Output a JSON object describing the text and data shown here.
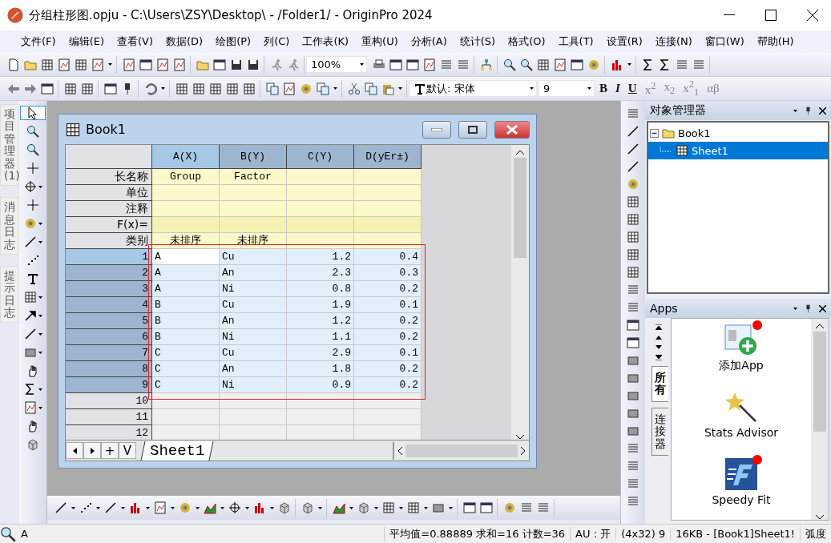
{
  "window": {
    "title": "分组柱形图.opju - C:\\Users\\ZSY\\Desktop\\ - /Folder1/ - OriginPro 2024"
  },
  "menu": [
    "文件(F)",
    "编辑(E)",
    "查看(V)",
    "数据(D)",
    "绘图(P)",
    "列(C)",
    "工作表(K)",
    "重构(U)",
    "分析(A)",
    "统计(S)",
    "格式(O)",
    "工具(T)",
    "设置(R)",
    "连接(N)",
    "窗口(W)",
    "帮助(H)"
  ],
  "toolbar": {
    "zoom": "100%",
    "font": "默认: 宋体",
    "font_size": "9",
    "format_buttons": [
      {
        "label": "B",
        "kind": "bold"
      },
      {
        "label": "I",
        "kind": "italic"
      },
      {
        "label": "U",
        "kind": "underline"
      },
      {
        "label": "x$^{2}$",
        "kind": "script"
      },
      {
        "label": "x$_{2}$",
        "kind": "script"
      },
      {
        "label": "x$^{2}$$_{1}$",
        "kind": "script"
      },
      {
        "label": "αβ",
        "kind": "script"
      }
    ]
  },
  "side_tabs": [
    {
      "label": "项目管理器 (1)"
    },
    {
      "label": "消息日志"
    },
    {
      "label": "提示日志"
    }
  ],
  "workbook": {
    "title": "Book1",
    "columns": [
      {
        "label": "A(X)",
        "selected": true
      },
      {
        "label": "B(Y)",
        "selected": false
      },
      {
        "label": "C(Y)",
        "selected": false
      },
      {
        "label": "D(yEr±)",
        "selected": false
      }
    ],
    "label_rows": [
      {
        "label": "长名称",
        "cells": [
          "Group",
          "Factor",
          null,
          null
        ]
      },
      {
        "label": "单位",
        "cells": [
          null,
          null,
          null,
          null
        ]
      },
      {
        "label": "注释",
        "cells": [
          null,
          null,
          null,
          null
        ]
      },
      {
        "label": "F(x)=",
        "cells": [
          null,
          null,
          null,
          null
        ]
      },
      {
        "label": "类别",
        "cells": [
          "未排序",
          "未排序",
          null,
          null
        ]
      }
    ],
    "rows": [
      {
        "label": "1",
        "selected": true,
        "active": true,
        "cells": [
          "A",
          "Cu",
          "1.2",
          "0.4"
        ]
      },
      {
        "label": "2",
        "selected": true,
        "active": false,
        "cells": [
          "A",
          "An",
          "2.3",
          "0.3"
        ]
      },
      {
        "label": "3",
        "selected": true,
        "active": false,
        "cells": [
          "A",
          "Ni",
          "0.8",
          "0.2"
        ]
      },
      {
        "label": "4",
        "selected": true,
        "active": false,
        "cells": [
          "B",
          "Cu",
          "1.9",
          "0.1"
        ]
      },
      {
        "label": "5",
        "selected": true,
        "active": false,
        "cells": [
          "B",
          "An",
          "1.2",
          "0.2"
        ]
      },
      {
        "label": "6",
        "selected": true,
        "active": false,
        "cells": [
          "B",
          "Ni",
          "1.1",
          "0.2"
        ]
      },
      {
        "label": "7",
        "selected": true,
        "active": false,
        "cells": [
          "C",
          "Cu",
          "2.9",
          "0.1"
        ]
      },
      {
        "label": "8",
        "selected": true,
        "active": false,
        "cells": [
          "C",
          "An",
          "1.8",
          "0.2"
        ]
      },
      {
        "label": "9",
        "selected": true,
        "active": false,
        "cells": [
          "C",
          "Ni",
          "0.9",
          "0.2"
        ]
      },
      {
        "label": "10",
        "selected": false,
        "active": false,
        "cells": [
          null,
          null,
          null,
          null
        ]
      },
      {
        "label": "11",
        "selected": false,
        "active": false,
        "cells": [
          null,
          null,
          null,
          null
        ]
      },
      {
        "label": "12",
        "selected": false,
        "active": false,
        "cells": [
          null,
          null,
          null,
          null
        ]
      }
    ],
    "sheet_nav": [
      "+",
      "V"
    ],
    "sheet_tabs": [
      {
        "label": "Sheet1",
        "selected": true
      }
    ]
  },
  "object_manager": {
    "title": "对象管理器",
    "tree": [
      {
        "label": "Book1",
        "expanded": true,
        "selected": false,
        "children": [
          {
            "label": "Sheet1",
            "selected": true
          }
        ]
      }
    ]
  },
  "apps": {
    "title": "Apps",
    "tabs": [
      {
        "label": "所有",
        "selected": true
      },
      {
        "label": "连接器",
        "selected": false
      }
    ],
    "items": [
      {
        "label": "添加App",
        "kind": "add",
        "badge": true
      },
      {
        "label": "Stats Advisor",
        "kind": "wand",
        "badge": false
      },
      {
        "label": "Speedy Fit",
        "kind": "fit",
        "badge": true
      }
    ]
  },
  "status_bar": [
    "A",
    "平均值=0.88889 求和=16 计数=36",
    "AU : 开",
    "(4x32) 9",
    "16KB - [Book1]Sheet1!",
    "弧度"
  ]
}
